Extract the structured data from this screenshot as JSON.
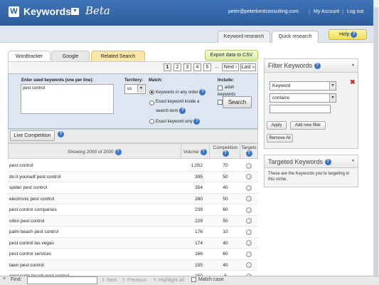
{
  "header": {
    "logo_letter": "W",
    "app_title": "Keywords",
    "beta": "Beta",
    "user_email": "peter@peterkentconsulting.com",
    "my_account": "My Account",
    "logout": "Log out"
  },
  "top_tabs": {
    "keyword_research": "Keyword research",
    "quick_research": "Quick research",
    "help": "Help"
  },
  "source_tabs": [
    "Wordtracker",
    "Google",
    "Related Search"
  ],
  "export_label": "Export data to CSV",
  "pager": {
    "pages": [
      "1",
      "2",
      "3",
      "4",
      "5"
    ],
    "ellipsis": "...",
    "next": "Next ›",
    "last": "Last »"
  },
  "form": {
    "seed_label": "Enter seed keywords (one per line):",
    "seed_value": "pest control",
    "territory_label": "Territory:",
    "territory_value": "us",
    "match_label": "Match:",
    "match_opt1": "Keywords in any order",
    "match_opt2a": "Exact keyword inside a",
    "match_opt2b": "search term",
    "match_opt3": "Exact keyword only",
    "include_label": "Include:",
    "include_adult": "adult",
    "include_keywords": "keywords",
    "search_button": "Search"
  },
  "live_competition": "Live Competition",
  "table": {
    "showing": "Showing 2000 of 2000",
    "col_volume": "Volume",
    "col_competition": "Competition",
    "col_targets": "Targets",
    "rows": [
      {
        "keyword": "pest control",
        "volume": "1,052",
        "competition": "70"
      },
      {
        "keyword": "do it yourself pest control",
        "volume": "395",
        "competition": "50"
      },
      {
        "keyword": "spider pest control",
        "volume": "354",
        "competition": "40"
      },
      {
        "keyword": "electronic pest control",
        "volume": "280",
        "competition": "50"
      },
      {
        "keyword": "pest control companies",
        "volume": "239",
        "competition": "60"
      },
      {
        "keyword": "orkin pest control",
        "volume": "229",
        "competition": "50"
      },
      {
        "keyword": "palm beach pest control",
        "volume": "176",
        "competition": "10"
      },
      {
        "keyword": "pest control las vegas",
        "volume": "174",
        "competition": "40"
      },
      {
        "keyword": "pest control services",
        "volume": "166",
        "competition": "60"
      },
      {
        "keyword": "lawn pest control",
        "volume": "155",
        "competition": "40"
      },
      {
        "keyword": "west palm beach pest control",
        "volume": "150",
        "competition": "6"
      }
    ]
  },
  "filter": {
    "title": "Filter Keywords",
    "field_value": "Keyword",
    "operator_value": "contains",
    "text_value": "",
    "apply": "Apply",
    "add_new_filter": "Add new filter",
    "remove_all": "Remove All"
  },
  "targeted": {
    "title": "Targeted Keywords",
    "description": "These are the Keywords you're targeting in this niche."
  },
  "findbar": {
    "close": "×",
    "find_label": "Find:",
    "next": "Next",
    "previous": "Previous",
    "highlight_all": "Highlight all",
    "match_case": "Match case"
  }
}
